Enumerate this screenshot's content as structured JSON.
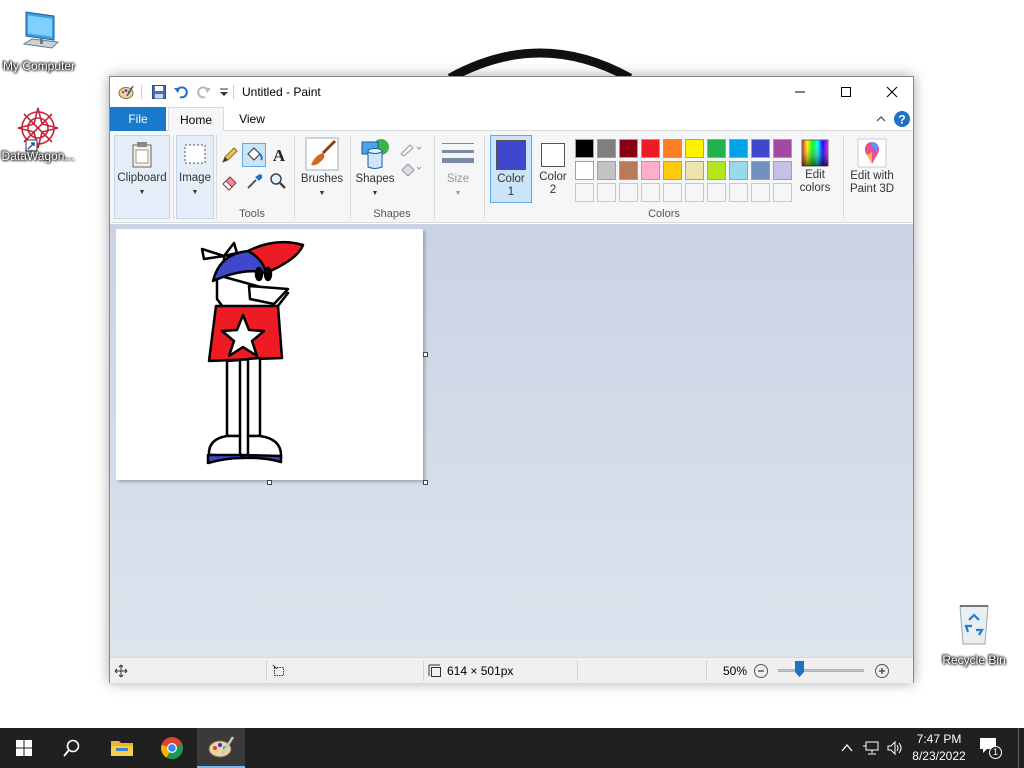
{
  "desktop": {
    "icons": [
      {
        "label": "My Computer",
        "icon": "computer-icon"
      },
      {
        "label": "DataWagon...",
        "icon": "datawagon-shortcut-icon"
      },
      {
        "label": "Recycle Bin",
        "icon": "recycle-bin-icon"
      }
    ]
  },
  "window": {
    "title": "Untitled - Paint",
    "tabs": [
      {
        "label": "File"
      },
      {
        "label": "Home"
      },
      {
        "label": "View"
      }
    ],
    "ribbon": {
      "clipboard_label": "Clipboard",
      "image_label": "Image",
      "tools_group": "Tools",
      "brushes_label": "Brushes",
      "shapes_label": "Shapes",
      "shapes_group": "Shapes",
      "size_label": "Size",
      "color1_line1": "Color",
      "color1_line2": "1",
      "color2_line1": "Color",
      "color2_line2": "2",
      "colors_group": "Colors",
      "edit_colors_line1": "Edit",
      "edit_colors_line2": "colors",
      "paint3d_line1": "Edit with",
      "paint3d_line2": "Paint 3D",
      "color1": "#3f48cc",
      "color2": "#ffffff",
      "palette_row1": [
        "#000000",
        "#7f7f7f",
        "#880015",
        "#ed1c24",
        "#ff7f27",
        "#fff200",
        "#22b14c",
        "#00a2e8",
        "#3f48cc",
        "#a349a4"
      ],
      "palette_row2": [
        "#ffffff",
        "#c3c3c3",
        "#b97a57",
        "#ffaec9",
        "#ffc90e",
        "#efe4b0",
        "#b5e61d",
        "#99d9ea",
        "#7092be",
        "#c8bfe7"
      ]
    },
    "status": {
      "image_size": "614 × 501px",
      "zoom": "50%",
      "zoom_fraction": 0.25
    }
  },
  "taskbar": {
    "time": "7:47 PM",
    "date": "8/23/2022",
    "notifications": "1"
  }
}
